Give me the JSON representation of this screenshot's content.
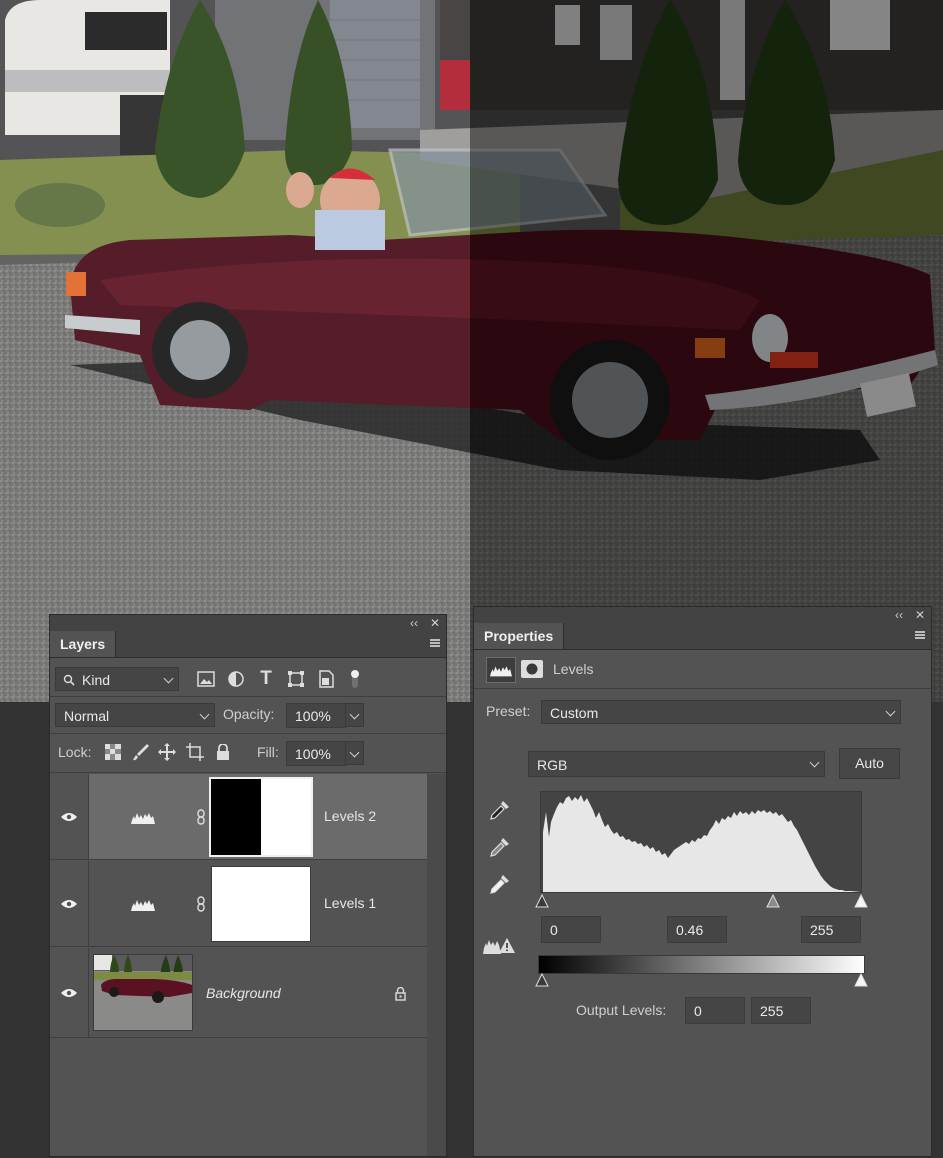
{
  "layers_panel": {
    "tab_label": "Layers",
    "filter_kind": "Kind",
    "blend_mode": "Normal",
    "opacity_label": "Opacity:",
    "opacity_value": "100%",
    "lock_label": "Lock:",
    "fill_label": "Fill:",
    "fill_value": "100%",
    "layers": [
      {
        "name": "Levels 2",
        "type": "adjustment",
        "mask": "half-black",
        "selected": true
      },
      {
        "name": "Levels 1",
        "type": "adjustment",
        "mask": "white",
        "selected": false
      },
      {
        "name": "Background",
        "type": "image",
        "locked": true,
        "selected": false
      }
    ]
  },
  "properties_panel": {
    "tab_label": "Properties",
    "adjustment_title": "Levels",
    "preset_label": "Preset:",
    "preset_value": "Custom",
    "channel_value": "RGB",
    "auto_label": "Auto",
    "input_black": "0",
    "input_gamma": "0.46",
    "input_white": "255",
    "output_label": "Output Levels:",
    "output_black": "0",
    "output_white": "255"
  },
  "icons": [
    "search-icon",
    "pixel-filter-icon",
    "adjustment-filter-icon",
    "type-filter-icon",
    "shape-filter-icon",
    "smart-object-filter-icon",
    "filter-toggle-icon",
    "lock-transparency-icon",
    "lock-pixels-icon",
    "lock-position-icon",
    "lock-artboard-icon",
    "lock-all-icon",
    "eye-icon",
    "levels-icon",
    "link-icon",
    "lock-icon",
    "black-eyedropper-icon",
    "gray-eyedropper-icon",
    "white-eyedropper-icon",
    "clipping-warning-icon",
    "mask-icon"
  ],
  "colors": {
    "panel_bg": "#535353",
    "selected_row": "#6b6b6b",
    "car_body": "#4a0f1c"
  }
}
